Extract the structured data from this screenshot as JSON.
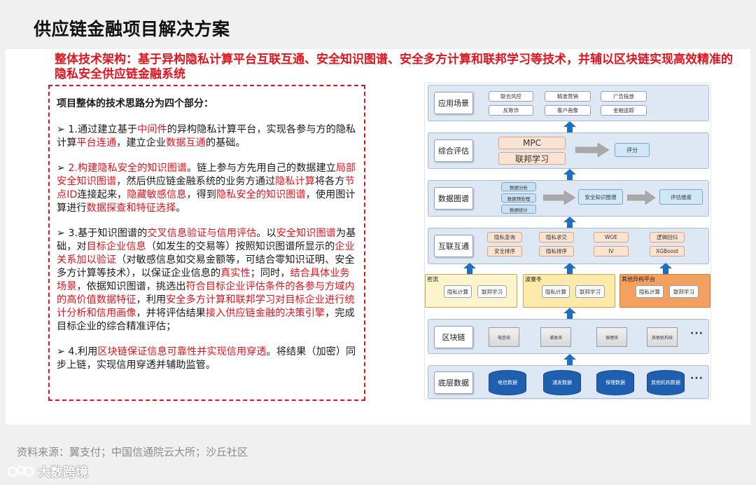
{
  "title": "供应链金融项目解决方案",
  "headline": "整体技术架构：基于异构隐私计算平台互联互通、安全知识图谱、安全多方计算和联邦学习等技术，并辅以区块链实现高效精准的隐私安全供应链金融系统",
  "intro": "项目整体的技术思路分为四个部分：",
  "points": [
    [
      {
        "t": "1.通过建立基于",
        "s": ""
      },
      {
        "t": "中间件",
        "s": "red"
      },
      {
        "t": "的异构隐私计算平台，实现各参与方的隐私计算",
        "s": ""
      },
      {
        "t": "平台连通",
        "s": "red"
      },
      {
        "t": "，建立企业",
        "s": ""
      },
      {
        "t": "数据互通",
        "s": "red"
      },
      {
        "t": "的基础。",
        "s": ""
      }
    ],
    [
      {
        "t": "2.构建隐私安全的知识图谱",
        "s": "red"
      },
      {
        "t": "。链上参与方先用自己的数据建立",
        "s": ""
      },
      {
        "t": "局部安全知识图谱",
        "s": "red"
      },
      {
        "t": "，然后供应链金融系统的业务方通过",
        "s": ""
      },
      {
        "t": "隐私计算",
        "s": "red"
      },
      {
        "t": "将各方",
        "s": ""
      },
      {
        "t": "节点ID",
        "s": "red"
      },
      {
        "t": "连接起来，",
        "s": ""
      },
      {
        "t": "隐藏敏感信息",
        "s": "red"
      },
      {
        "t": "，得到",
        "s": ""
      },
      {
        "t": "隐私安全的知识图谱",
        "s": "red"
      },
      {
        "t": "，使用图计算进行",
        "s": ""
      },
      {
        "t": "数据探查和特征选择",
        "s": "red"
      },
      {
        "t": "。",
        "s": ""
      }
    ],
    [
      {
        "t": "3.基于知识图谱的",
        "s": ""
      },
      {
        "t": "交叉信息验证与信用评估",
        "s": "red"
      },
      {
        "t": "。以",
        "s": ""
      },
      {
        "t": "安全知识图谱",
        "s": "red"
      },
      {
        "t": "为基础，对",
        "s": ""
      },
      {
        "t": "目标企业信息",
        "s": "red"
      },
      {
        "t": "（如发生的交易等）按照知识图谱所显示的",
        "s": ""
      },
      {
        "t": "企业关系加以验证",
        "s": "red"
      },
      {
        "t": "（对敏感信息如交易金额等，可结合零知识证明、安全多方计算等技术），以保证企业信息的",
        "s": ""
      },
      {
        "t": "真实性",
        "s": "red"
      },
      {
        "t": "；同时，",
        "s": ""
      },
      {
        "t": "结合具体业务场景",
        "s": "red"
      },
      {
        "t": "，依据知识图谱，挑选出",
        "s": ""
      },
      {
        "t": "符合目标企业评估条件的各参与方域内的高价值数据特征",
        "s": "red"
      },
      {
        "t": "，利用",
        "s": ""
      },
      {
        "t": "安全多方计算和联邦学习对目标企业进行统计分析和信用画像",
        "s": "red"
      },
      {
        "t": "，并将评估结果",
        "s": ""
      },
      {
        "t": "接入供应链金融的决策引擎",
        "s": "red"
      },
      {
        "t": "，完成目标企业的综合精准评估；",
        "s": ""
      }
    ],
    [
      {
        "t": "4.利用",
        "s": ""
      },
      {
        "t": "区块链保证信息可靠性并实现信用穿透",
        "s": "red"
      },
      {
        "t": "。将结果（加密）同步上链，实现信用穿透并辅助监管。",
        "s": ""
      }
    ]
  ],
  "diagram": {
    "layers": {
      "app": "应用场景",
      "eval": "综合评估",
      "graph": "数据图谱",
      "interop": "互联互通",
      "chain": "区块链",
      "data": "底层数据"
    },
    "app_items": [
      "联合风控",
      "精准营销",
      "广告投放",
      "反欺诈",
      "客户画像",
      "金融追踪"
    ],
    "eval_items": {
      "mpc": "MPC",
      "fl": "联邦学习",
      "score": "评分"
    },
    "graph_items": {
      "inputs": [
        "数据分析",
        "数据预处理",
        "数据统计"
      ],
      "kg": "安全知识图谱",
      "dim": "评估维度"
    },
    "interop_items": [
      "隐私查询",
      "隐私求交",
      "WOE",
      "逻辑回归",
      "安全排序",
      "隐私排序",
      "IV",
      "XGBoost"
    ],
    "parties": [
      {
        "name": "密流",
        "a": "隐私计算",
        "b": "联邦学习"
      },
      {
        "name": "波塞冬",
        "a": "隐私计算",
        "b": "联邦学习"
      },
      {
        "name": "其他异构平台",
        "a": "隐私计算",
        "b": "联邦学习"
      }
    ],
    "chain_items": [
      "电信块",
      "浦发块",
      "保理块",
      "其他机构块"
    ],
    "data_items": [
      "电信数据",
      "浦发数据",
      "保理数据",
      "其他机构数据"
    ],
    "ellipsis": "···"
  },
  "source": "资料来源：翼支付；中国信通院云大所；沙丘社区",
  "logo": "大数跨境",
  "colors": {
    "accent": "#e0141e",
    "arrow": "#1f6fc0",
    "layer": "#dde8f4"
  }
}
